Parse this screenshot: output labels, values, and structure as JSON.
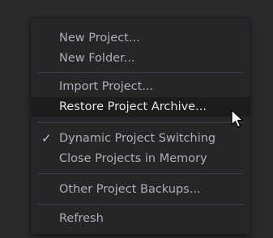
{
  "menu": {
    "items": [
      {
        "label": "New Project..."
      },
      {
        "label": "New Folder..."
      },
      {
        "label": "Import Project..."
      },
      {
        "label": "Restore Project Archive..."
      },
      {
        "label": "Dynamic Project Switching",
        "checked": true
      },
      {
        "label": "Close Projects in Memory"
      },
      {
        "label": "Other Project Backups..."
      },
      {
        "label": "Refresh"
      }
    ],
    "check_glyph": "✓",
    "hovered_item": "Restore Project Archive..."
  },
  "icons": {
    "cursor": "arrow-pointer-icon",
    "check": "checkmark-icon"
  },
  "colors": {
    "background": "#2b2b2e",
    "menu_bg": "#262628",
    "hover_bg": "#1c1c1e",
    "text": "#b0b0b4",
    "text_hover": "#e6e6e9",
    "separator": "#3f3f43"
  }
}
